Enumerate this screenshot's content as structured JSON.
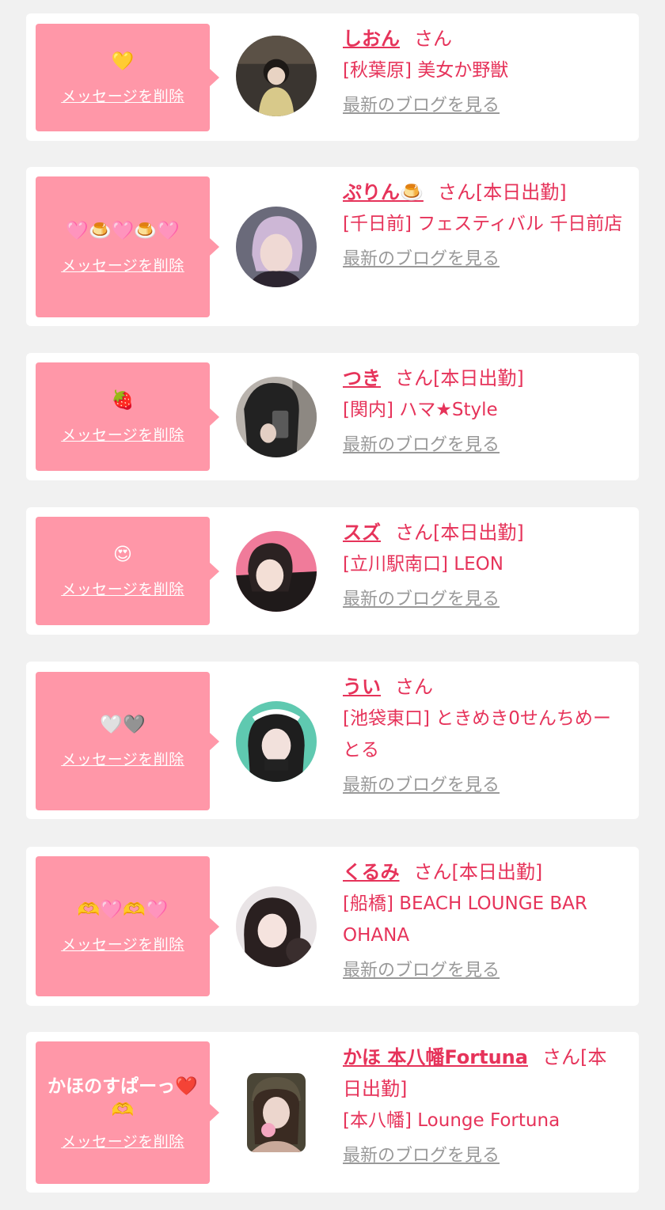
{
  "delete_label": "メッセージを削除",
  "blog_label": "最新のブログを見る",
  "colors": {
    "background": "#f1f1f1",
    "bubble": "#ff97a8",
    "accent": "#e6335a",
    "muted": "#999999"
  },
  "messages": [
    {
      "message": "💛",
      "name": "しおん",
      "suffix": "さん",
      "shop": "[秋葉原] 美女か野獣",
      "avatar_colors": [
        "#3a3530",
        "#b7a98c"
      ]
    },
    {
      "message": "🩷🍮🩷🍮🩷",
      "name": "ぷりん🍮",
      "suffix": "さん[本日出勤]",
      "shop": "[千日前] フェスティバル 千日前店",
      "avatar_colors": [
        "#6a6a7a",
        "#d8c0c0"
      ]
    },
    {
      "message": "🍓",
      "name": "つき",
      "suffix": "さん[本日出勤]",
      "shop": "[関内] ハマ★Style",
      "avatar_colors": [
        "#2a2a2a",
        "#b9b3ad"
      ]
    },
    {
      "message": "😍",
      "name": "スズ",
      "suffix": "さん[本日出勤]",
      "shop": "[立川駅南口] LEON",
      "avatar_colors": [
        "#f07b9a",
        "#2b2222"
      ]
    },
    {
      "message": "🤍🩶",
      "name": "うい",
      "suffix": "さん",
      "shop": "[池袋東口] ときめき0せんちめーとる",
      "avatar_colors": [
        "#5fc9b0",
        "#1e1e1e"
      ]
    },
    {
      "message": "🫶🩷🫶🩷",
      "name": "くるみ",
      "suffix": "さん[本日出勤]",
      "shop": "[船橋] BEACH LOUNGE BAR OHANA",
      "avatar_colors": [
        "#e9e4e6",
        "#2a2020"
      ]
    },
    {
      "message": "かほのすぱーっ❤️🫶",
      "name": "かほ 本八幡Fortuna",
      "suffix": "さん[本日出勤]",
      "shop": "[本八幡] Lounge Fortuna",
      "avatar_colors": [
        "#4a4536",
        "#c9a99a"
      ]
    }
  ]
}
